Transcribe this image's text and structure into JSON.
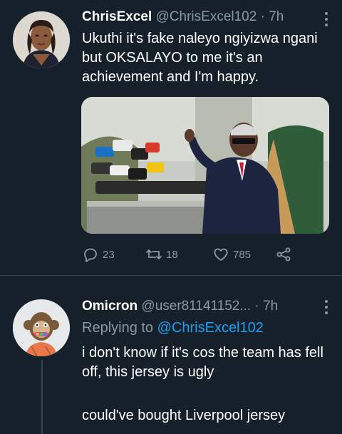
{
  "tweet1": {
    "name": "ChrisExcel",
    "handle": "@ChrisExcel102",
    "dot": "·",
    "time": "7h",
    "text": "Ukuthi it's fake naleyo ngiyizwa ngani but OKSALAYO to me it's an achievement and I'm happy.",
    "actions": {
      "replies": "23",
      "retweets": "18",
      "likes": "785"
    }
  },
  "tweet2": {
    "name": "Omicron",
    "handle": "@user81141152...",
    "dot": "·",
    "time": "7h",
    "replying_prefix": "Replying to",
    "replying_to": "@ChrisExcel102",
    "text_line1": "i don't know if it's cos the team has fell off, this jersey is ugly",
    "text_line2": "could've bought Liverpool jersey"
  },
  "colors": {
    "background": "#15202b",
    "secondary_text": "#8899a6",
    "link": "#1da1f2",
    "divider": "#38444d"
  },
  "icons": [
    "reply-icon",
    "retweet-icon",
    "like-icon",
    "share-icon",
    "more-icon"
  ]
}
